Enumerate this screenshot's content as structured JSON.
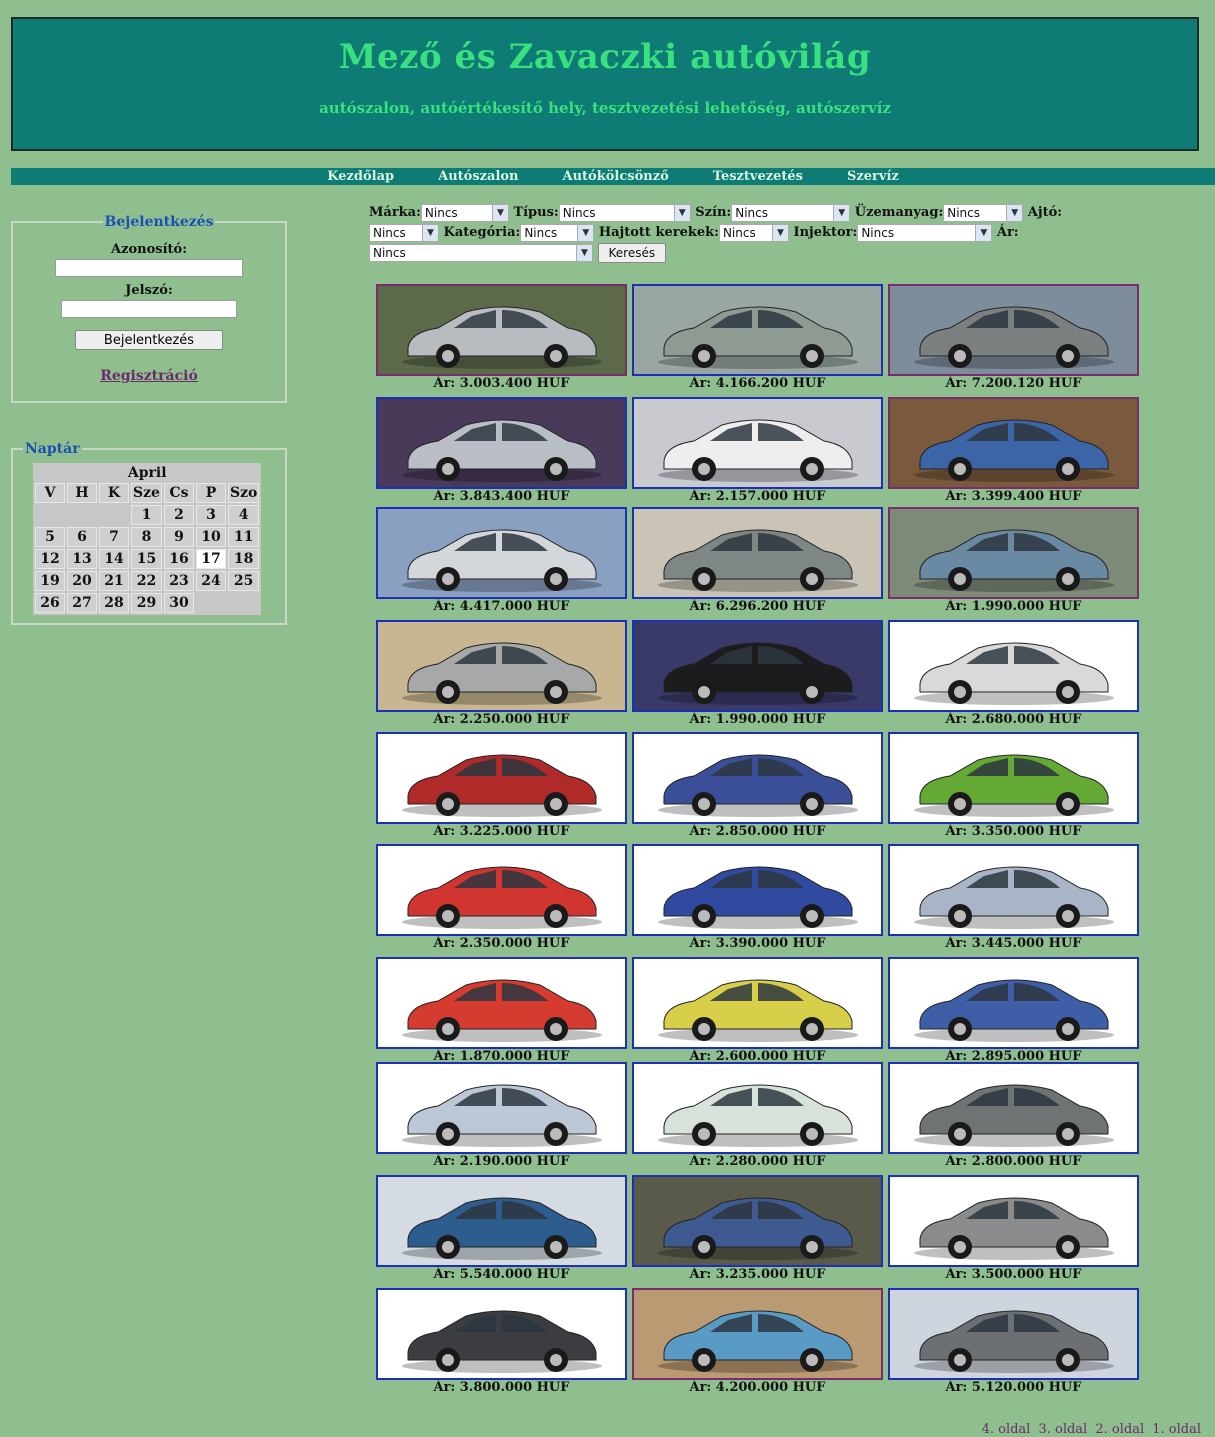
{
  "header": {
    "title": "Mező és Zavaczki autóvilág",
    "subtitle": "autószalon, autóértékesítő hely, tesztvezetési lehetőség, autószervíz"
  },
  "nav": [
    "Kezdőlap",
    "Autószalon",
    "Autókölcsönző",
    "Tesztvezetés",
    "Szervíz"
  ],
  "login": {
    "legend": "Bejelentkezés",
    "user_label": "Azonosító:",
    "pass_label": "Jelszó:",
    "button": "Bejelentkezés",
    "register": "Regisztráció"
  },
  "calendar": {
    "legend": "Naptár",
    "month": "April",
    "days": [
      "V",
      "H",
      "K",
      "Sze",
      "Cs",
      "P",
      "Szo"
    ],
    "weeks": [
      [
        "",
        "",
        "",
        "1",
        "2",
        "3",
        "4"
      ],
      [
        "5",
        "6",
        "7",
        "8",
        "9",
        "10",
        "11"
      ],
      [
        "12",
        "13",
        "14",
        "15",
        "16",
        "17",
        "18"
      ],
      [
        "19",
        "20",
        "21",
        "22",
        "23",
        "24",
        "25"
      ],
      [
        "26",
        "27",
        "28",
        "29",
        "30",
        "",
        ""
      ]
    ],
    "today": "17"
  },
  "search": {
    "marka_label": "Márka:",
    "tipus_label": "Típus:",
    "szin_label": "Szín:",
    "uzemanyag_label": "Üzemanyag:",
    "ajto_label": "Ajtó:",
    "kategoria_label": "Kategória:",
    "hajtott_label": "Hajtott kerekek:",
    "injektor_label": "Injektor:",
    "ar_label": "Ár:",
    "default_option": "Nincs",
    "button": "Keresés"
  },
  "cars": [
    {
      "price": "Ár: 3.003.400 HUF",
      "color": "#b8bcc0",
      "bg": "#5d6a4a",
      "border": "#7a2c6e"
    },
    {
      "price": "Ár: 4.166.200 HUF",
      "color": "#8f9a93",
      "bg": "#9aa6a2",
      "border": "#1d2fb8"
    },
    {
      "price": "Ár: 7.200.120 HUF",
      "color": "#7a7f80",
      "bg": "#7e8d9c",
      "border": "#7a2c6e"
    },
    {
      "price": "Ár: 3.843.400 HUF",
      "color": "#b9bec6",
      "bg": "#4a3a5a",
      "border": "#1d2fb8"
    },
    {
      "price": "Ár: 2.157.000 HUF",
      "color": "#eeeeee",
      "bg": "#c8cad0",
      "border": "#1d2fb8"
    },
    {
      "price": "Ár: 3.399.400 HUF",
      "color": "#3c65a8",
      "bg": "#7a5a3c",
      "border": "#7a2c6e"
    },
    {
      "price": "Ár: 4.417.000 HUF",
      "color": "#d3d6da",
      "bg": "#8aa0c0",
      "border": "#1d2fb8"
    },
    {
      "price": "Ár: 6.296.200 HUF",
      "color": "#7f8686",
      "bg": "#c9c4b6",
      "border": "#1d2fb8"
    },
    {
      "price": "Ár: 1.990.000 HUF",
      "color": "#6a8aa3",
      "bg": "#7d8a78",
      "border": "#7a2c6e"
    },
    {
      "price": "Ár: 2.250.000 HUF",
      "color": "#a7a8a8",
      "bg": "#c7b68f",
      "border": "#1d2fb8"
    },
    {
      "price": "Ár: 1.990.000 HUF",
      "color": "#1c1c1e",
      "bg": "#3a3a6a",
      "border": "#1d2fb8"
    },
    {
      "price": "Ár: 2.680.000 HUF",
      "color": "#d9d9d9",
      "bg": "#ffffff",
      "border": "#1d2fb8"
    },
    {
      "price": "Ár: 3.225.000 HUF",
      "color": "#b02a2a",
      "bg": "#ffffff",
      "border": "#1d2fb8"
    },
    {
      "price": "Ár: 2.850.000 HUF",
      "color": "#3a4f97",
      "bg": "#ffffff",
      "border": "#1d2fb8"
    },
    {
      "price": "Ár: 3.350.000 HUF",
      "color": "#63a934",
      "bg": "#ffffff",
      "border": "#1d2fb8"
    },
    {
      "price": "Ár: 2.350.000 HUF",
      "color": "#d0362f",
      "bg": "#ffffff",
      "border": "#1d2fb8"
    },
    {
      "price": "Ár: 3.390.000 HUF",
      "color": "#2f4a9e",
      "bg": "#ffffff",
      "border": "#1d2fb8"
    },
    {
      "price": "Ár: 3.445.000 HUF",
      "color": "#a9b5c6",
      "bg": "#ffffff",
      "border": "#1d2fb8"
    },
    {
      "price": "Ár: 1.870.000 HUF",
      "color": "#d63b2f",
      "bg": "#ffffff",
      "border": "#1d2fb8"
    },
    {
      "price": "Ár: 2.600.000 HUF",
      "color": "#d7cf4a",
      "bg": "#ffffff",
      "border": "#1d2fb8"
    },
    {
      "price": "Ár: 2.895.000 HUF",
      "color": "#3e5ea8",
      "bg": "#ffffff",
      "border": "#1d2fb8"
    },
    {
      "price": "Ár: 2.190.000 HUF",
      "color": "#bcc8d6",
      "bg": "#ffffff",
      "border": "#1d2fb8"
    },
    {
      "price": "Ár: 2.280.000 HUF",
      "color": "#d6e2da",
      "bg": "#ffffff",
      "border": "#1d2fb8"
    },
    {
      "price": "Ár: 2.800.000 HUF",
      "color": "#6f7373",
      "bg": "#ffffff",
      "border": "#1d2fb8"
    },
    {
      "price": "Ár: 5.540.000 HUF",
      "color": "#2d5c8f",
      "bg": "#d4dbe3",
      "border": "#1d2fb8"
    },
    {
      "price": "Ár: 3.235.000 HUF",
      "color": "#3e5a90",
      "bg": "#5a5a4a",
      "border": "#1d2fb8"
    },
    {
      "price": "Ár: 3.500.000 HUF",
      "color": "#8a8b8c",
      "bg": "#ffffff",
      "border": "#1d2fb8"
    },
    {
      "price": "Ár: 3.800.000 HUF",
      "color": "#3b3d40",
      "bg": "#ffffff",
      "border": "#1d2fb8"
    },
    {
      "price": "Ár: 4.200.000 HUF",
      "color": "#5a9bc6",
      "bg": "#b99a72",
      "border": "#7a2c6e"
    },
    {
      "price": "Ár: 5.120.000 HUF",
      "color": "#6c7074",
      "bg": "#cfd5de",
      "border": "#1d2fb8"
    }
  ],
  "pager": [
    "4. oldal",
    "3. oldal",
    "2. oldal",
    "1. oldal"
  ]
}
